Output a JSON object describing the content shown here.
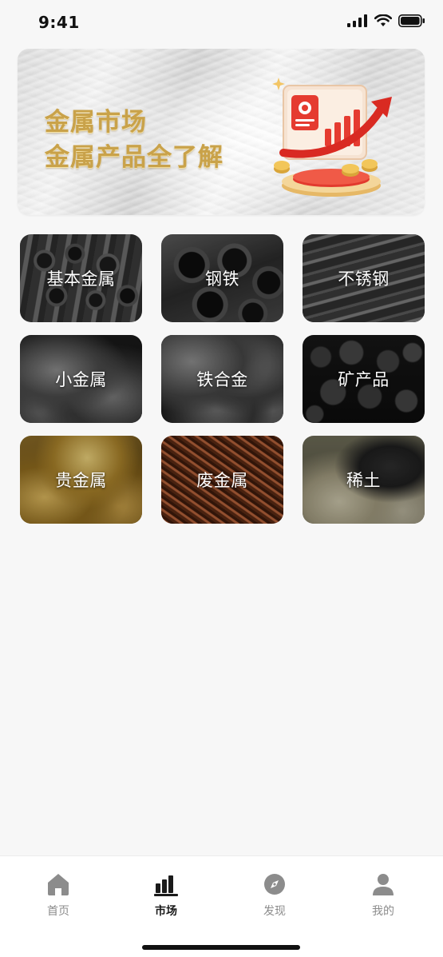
{
  "status_bar": {
    "time": "9:41"
  },
  "banner": {
    "line1": "金属市场",
    "line2": "金属产品全了解",
    "colors": {
      "text_gold": "#c9a24a",
      "accent_red": "#e23a2e"
    }
  },
  "categories": [
    {
      "label": "基本金属",
      "texture": "pipes"
    },
    {
      "label": "钢铁",
      "texture": "steel-tubes"
    },
    {
      "label": "不锈钢",
      "texture": "steel-plates"
    },
    {
      "label": "小金属",
      "texture": "metal-lumps"
    },
    {
      "label": "铁合金",
      "texture": "alloy-lumps"
    },
    {
      "label": "矿产品",
      "texture": "ore"
    },
    {
      "label": "贵金属",
      "texture": "gold-bars"
    },
    {
      "label": "废金属",
      "texture": "scrap-copper"
    },
    {
      "label": "稀土",
      "texture": "rare-earth-powder"
    }
  ],
  "tabbar": {
    "tabs": [
      {
        "label": "首页",
        "icon": "home-icon",
        "active": false
      },
      {
        "label": "市场",
        "icon": "bar-chart-icon",
        "active": true
      },
      {
        "label": "发现",
        "icon": "compass-icon",
        "active": false
      },
      {
        "label": "我的",
        "icon": "user-icon",
        "active": false
      }
    ],
    "colors": {
      "active": "#1a1a1a",
      "inactive": "#8c8c8c"
    }
  }
}
